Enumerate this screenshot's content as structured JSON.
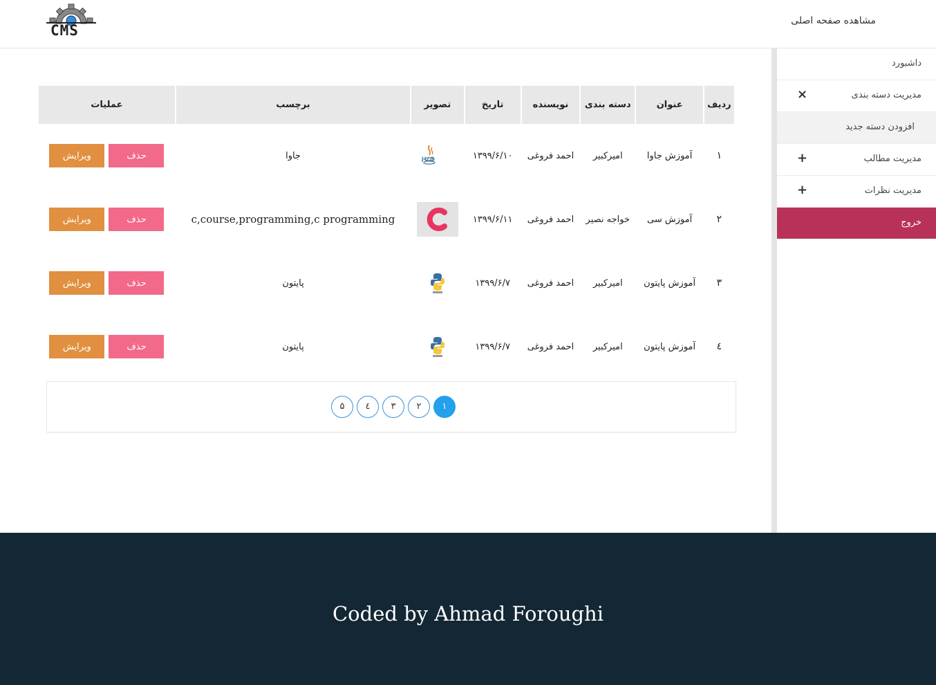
{
  "header": {
    "logo_text": "CMS",
    "home_link": "مشاهده صفحه اصلی"
  },
  "sidebar": {
    "items": [
      {
        "label": "داشبورد"
      },
      {
        "label": "مدیریت دسته بندی",
        "control": "×"
      },
      {
        "label": "افزودن دسته جدید"
      },
      {
        "label": "مدیریت مطالب",
        "control": "+"
      },
      {
        "label": "مدیریت نظرات",
        "control": "+"
      },
      {
        "label": "خروج"
      }
    ]
  },
  "table": {
    "headers": [
      "ردیف",
      "عنوان",
      "دسته بندی",
      "نویسنده",
      "تاریخ",
      "تصویر",
      "برچسب",
      "عملیات"
    ],
    "rows": [
      {
        "num": "۱",
        "title": "آموزش جاوا",
        "category": "امیرکبیر",
        "author": "احمد فروغی",
        "date": "۱۳۹۹/۶/۱۰",
        "image": "java-logo",
        "tags": "جاوا"
      },
      {
        "num": "۲",
        "title": "آموزش سی",
        "category": "خواجه نصیر",
        "author": "احمد فروغی",
        "date": "۱۳۹۹/۶/۱۱",
        "image": "c-logo",
        "tags": "c,course,programming,c programming"
      },
      {
        "num": "۳",
        "title": "آموزش پایتون",
        "category": "امیرکبیر",
        "author": "احمد فروغی",
        "date": "۱۳۹۹/۶/۷",
        "image": "python-logo",
        "tags": "پایتون"
      },
      {
        "num": "٤",
        "title": "آموزش پایتون",
        "category": "امیرکبیر",
        "author": "احمد فروغی",
        "date": "۱۳۹۹/۶/۷",
        "image": "python-logo",
        "tags": "پایتون"
      }
    ],
    "delete_label": "حذف",
    "edit_label": "ویرایش"
  },
  "pagination": {
    "pages": [
      "۱",
      "۲",
      "۳",
      "٤",
      "۵"
    ],
    "active": "۱"
  },
  "footer": {
    "text": "Coded by Ahmad Foroughi"
  },
  "colors": {
    "edit": "#e09040",
    "delete": "#f2698a",
    "logout": "#b83159",
    "footer": "#132735",
    "page_active": "#24a0ec"
  }
}
